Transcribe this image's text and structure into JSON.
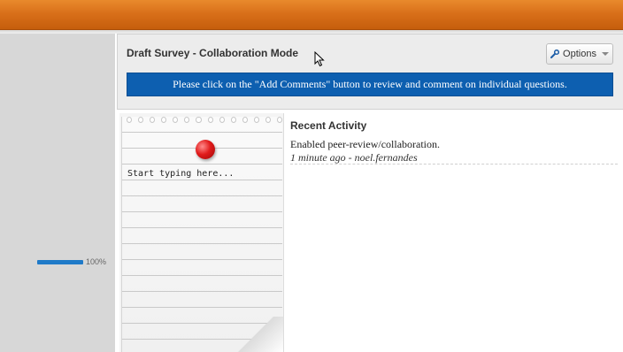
{
  "survey": {
    "title": "Draft Survey - Collaboration Mode",
    "options_label": "Options",
    "banner": "Please click on the \"Add Comments\" button to review and comment on individual questions."
  },
  "progress": {
    "value": 1.0,
    "label": "100%"
  },
  "notepad": {
    "placeholder": "Start typing here..."
  },
  "activity": {
    "title": "Recent Activity",
    "items": [
      {
        "action": "Enabled peer-review/collaboration.",
        "meta": "1 minute ago - noel.fernandes"
      }
    ]
  },
  "colors": {
    "topbar": "#d9701a",
    "banner": "#0d5fb0",
    "progress": "#1f7ac8"
  }
}
